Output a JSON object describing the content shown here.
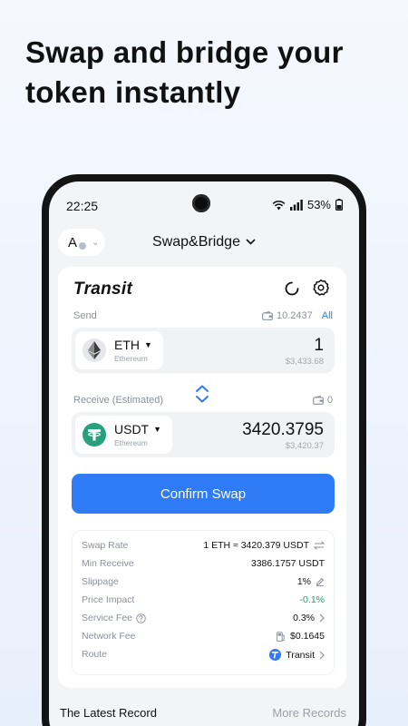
{
  "headline": {
    "line1": "Swap and bridge your",
    "line2": "token instantly"
  },
  "status": {
    "time": "22:25",
    "battery": "53%"
  },
  "header": {
    "account_letter": "A",
    "title": "Swap&Bridge"
  },
  "card": {
    "brand": "Transit",
    "send": {
      "label": "Send",
      "balance": "10.2437",
      "all_label": "All"
    },
    "from_token": {
      "symbol": "ETH",
      "chain": "Ethereum",
      "amount": "1",
      "usd": "$3,433.68"
    },
    "receive": {
      "label": "Receive (Estimated)",
      "balance": "0"
    },
    "to_token": {
      "symbol": "USDT",
      "chain": "Ethereum",
      "amount": "3420.3795",
      "usd": "$3,420.37"
    },
    "confirm_label": "Confirm Swap"
  },
  "details": [
    {
      "label": "Swap Rate",
      "value": "1 ETH ≈ 3420.379 USDT"
    },
    {
      "label": "Min Receive",
      "value": "3386.1757 USDT"
    },
    {
      "label": "Slippage",
      "value": "1%"
    },
    {
      "label": "Price Impact",
      "value": "-0.1%"
    },
    {
      "label": "Service Fee",
      "value": "0.3%"
    },
    {
      "label": "Network Fee",
      "value": "$0.1645"
    },
    {
      "label": "Route",
      "value": "Transit"
    }
  ],
  "footer": {
    "latest_label": "The Latest Record",
    "more_label": "More Records"
  },
  "colors": {
    "accent": "#2f7bf6",
    "positive": "#22a06b",
    "usdt": "#26a17b"
  }
}
